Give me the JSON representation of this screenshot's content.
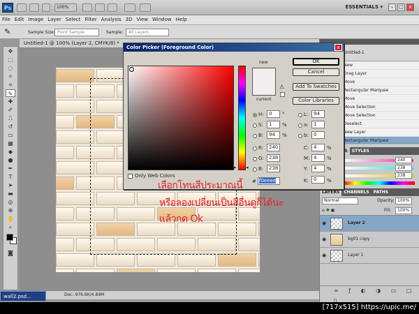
{
  "app": {
    "logo": "Ps",
    "zoom_value": "100%",
    "workspace": "ESSENTIALS ▾",
    "window_controls": [
      "–",
      "□",
      "x"
    ]
  },
  "menu": [
    "File",
    "Edit",
    "Image",
    "Layer",
    "Select",
    "Filter",
    "Analysis",
    "3D",
    "View",
    "Window",
    "Help"
  ],
  "options_bar": {
    "sample_size_label": "Sample Size:",
    "sample_size_value": "Point Sample",
    "sample_label": "Sample:",
    "sample_value": "All Layers"
  },
  "document": {
    "tab_title": "Untitled-1 @ 100% (Layer 2, CMYK/8) *",
    "status_text": "Doc: 976.6K/4.89M"
  },
  "color_picker": {
    "title": "Color Picker (Foreground Color)",
    "close": "x",
    "new_label": "new",
    "current_label": "current",
    "new_color": "#f0eeee",
    "current_color": "#f0eeee",
    "buttons": {
      "ok": "OK",
      "cancel": "Cancel",
      "add_swatches": "Add To Swatches",
      "color_libraries": "Color Libraries"
    },
    "only_web_colors": "Only Web Colors",
    "hsb": [
      {
        "label": "H:",
        "value": "0",
        "unit": "°",
        "selected": true
      },
      {
        "label": "S:",
        "value": "1",
        "unit": "%",
        "selected": false
      },
      {
        "label": "B:",
        "value": "94",
        "unit": "%",
        "selected": false
      }
    ],
    "rgb": [
      {
        "label": "R:",
        "value": "240"
      },
      {
        "label": "G:",
        "value": "238"
      },
      {
        "label": "B:",
        "value": "238"
      }
    ],
    "lab": [
      {
        "label": "L:",
        "value": "94"
      },
      {
        "label": "a:",
        "value": "1"
      },
      {
        "label": "b:",
        "value": "0"
      }
    ],
    "cmyk": [
      {
        "label": "C:",
        "value": "4",
        "unit": "%"
      },
      {
        "label": "M:",
        "value": "4",
        "unit": "%"
      },
      {
        "label": "Y:",
        "value": "4",
        "unit": "%"
      },
      {
        "label": "K:",
        "value": "0",
        "unit": "%"
      }
    ],
    "hex_label": "#",
    "hex_value": "f0eeee"
  },
  "annotation": {
    "line1": "เลือกโทนสีประมาณนี้",
    "line2": "หรือลองเปลี่ยนเป็นสีอื่นดูก็ได้นะ",
    "line3": "แล้วกด Ok"
  },
  "history": {
    "snapshot": "Untitled-1",
    "items": [
      "New",
      "Drag Layer",
      "Move",
      "Rectangular Marquee",
      "Move",
      "Move Selection",
      "Move Selection",
      "Deselect",
      "New Layer",
      "Rectangular Marquee"
    ]
  },
  "swatches_tabs": [
    "SWATCHES",
    "STYLES"
  ],
  "sliders": [
    {
      "value": "240",
      "color": "#e0299a"
    },
    {
      "value": "238",
      "color": "#2fd6cf"
    },
    {
      "value": "238",
      "color": "#d9c80f"
    }
  ],
  "layers_panel": {
    "tabs": [
      "LAYERS",
      "CHANNELS",
      "PATHS"
    ],
    "blend_mode": "Normal",
    "opacity_label": "Opacity:",
    "opacity_value": "100%",
    "fill_label": "Fill:",
    "fill_value": "100%",
    "layers": [
      {
        "name": "Layer 2",
        "active": true
      },
      {
        "name": "bg01 copy",
        "active": false
      },
      {
        "name": "Layer 1",
        "active": false
      }
    ]
  },
  "taskbar_item": "wall2.psd...",
  "watermark": "[717x515] https://upic.me/"
}
